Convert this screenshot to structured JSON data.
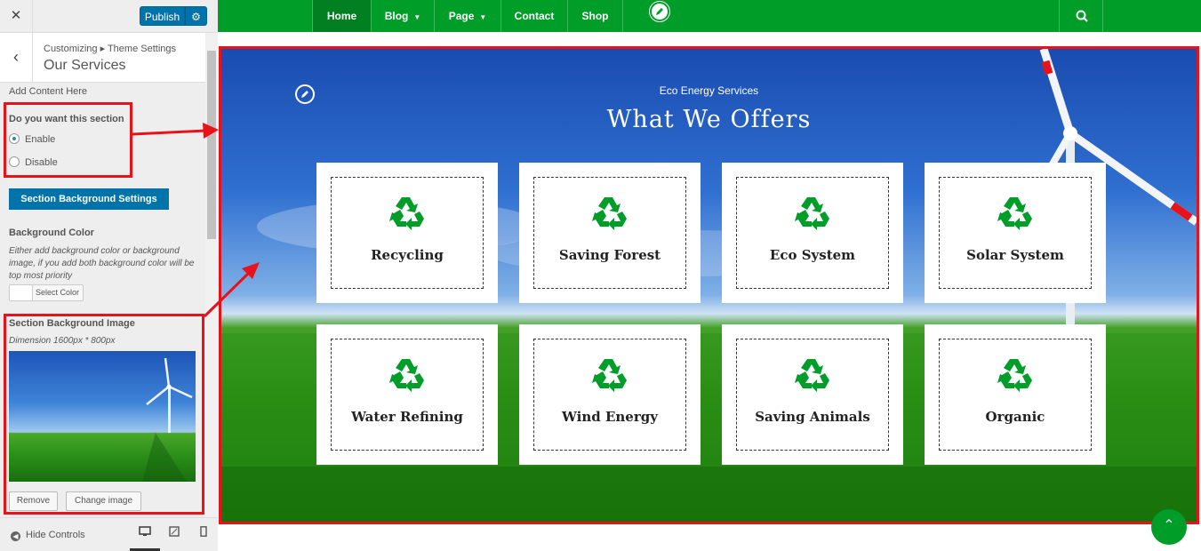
{
  "customizer": {
    "close_icon": "close-icon",
    "publish_label": "Publish",
    "settings_icon": "gear-icon",
    "breadcrumb": "Customizing ▸ Theme Settings",
    "section_title": "Our Services",
    "add_content": "Add Content Here",
    "section_toggle_label": "Do you want this section",
    "enable_label": "Enable",
    "disable_label": "Disable",
    "selected_option": "Enable",
    "bg_settings_button": "Section Background Settings",
    "bg_color_label": "Background Color",
    "bg_color_desc": "Either add background color or background image, if you add both background color will be top most priority",
    "select_color_label": "Select Color",
    "bg_image_label": "Section Background Image",
    "bg_image_dimension": "Dimension 1600px * 800px",
    "remove_label": "Remove",
    "change_image_label": "Change image",
    "hide_controls_label": "Hide Controls"
  },
  "navbar": {
    "items": [
      {
        "label": "Home",
        "active": true
      },
      {
        "label": "Blog",
        "has_caret": true
      },
      {
        "label": "Page",
        "has_caret": true
      },
      {
        "label": "Contact"
      },
      {
        "label": "Shop"
      }
    ],
    "search_icon": "search-icon",
    "edit_icon": "pencil-icon",
    "brand_color": "#019d29"
  },
  "services": {
    "subtitle": "Eco Energy Services",
    "title": "What We Offers",
    "items": [
      {
        "title": "Recycling",
        "icon": "recycle-icon"
      },
      {
        "title": "Saving Forest",
        "icon": "recycle-icon"
      },
      {
        "title": "Eco System",
        "icon": "recycle-icon"
      },
      {
        "title": "Solar System",
        "icon": "recycle-icon"
      },
      {
        "title": "Water Refining",
        "icon": "recycle-icon"
      },
      {
        "title": "Wind Energy",
        "icon": "recycle-icon"
      },
      {
        "title": "Saving Animals",
        "icon": "recycle-icon"
      },
      {
        "title": "Organic",
        "icon": "recycle-icon"
      }
    ],
    "icon_color": "#019d29",
    "highlight_color": "#e8131a"
  }
}
